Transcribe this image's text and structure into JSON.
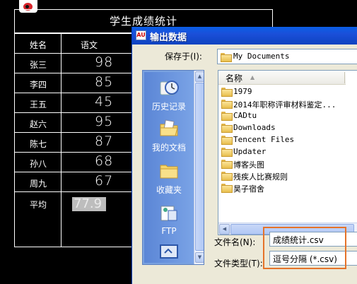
{
  "table": {
    "title": "学生成绩统计",
    "headers": [
      "姓名",
      "语文"
    ],
    "rows": [
      {
        "name": "张三",
        "score": "98"
      },
      {
        "name": "李四",
        "score": "85"
      },
      {
        "name": "王五",
        "score": "45"
      },
      {
        "name": "赵六",
        "score": "95"
      },
      {
        "name": "陈七",
        "score": "87"
      },
      {
        "name": "孙八",
        "score": "68"
      },
      {
        "name": "周九",
        "score": "67"
      }
    ],
    "average_label": "平均",
    "average_value": "77.9"
  },
  "dialog": {
    "title": "输出数据",
    "save_in_label": "保存于(I):",
    "save_in_value": "My Documents",
    "places": [
      {
        "label": "历史记录",
        "icon": "history-icon"
      },
      {
        "label": "我的文档",
        "icon": "my-documents-icon"
      },
      {
        "label": "收藏夹",
        "icon": "favorites-icon"
      },
      {
        "label": "FTP",
        "icon": "ftp-icon"
      },
      {
        "label": "",
        "icon": "desktop-icon"
      }
    ],
    "list_header": "名称",
    "files": [
      "1979",
      "2014年职称评审材料鉴定...",
      "CADtu",
      "Downloads",
      "Tencent Files",
      "Updater",
      "博客头图",
      "残疾人比赛规则",
      "昊子宿舍"
    ],
    "filename_label": "文件名(N):",
    "filename_value": "成绩统计.csv",
    "filetype_label": "文件类型(T):",
    "filetype_value": "逗号分隔 (*.csv)"
  },
  "colors": {
    "titlebar": "#0a5fe6",
    "highlight": "#e5732a",
    "dialog_bg": "#ece9d8"
  }
}
